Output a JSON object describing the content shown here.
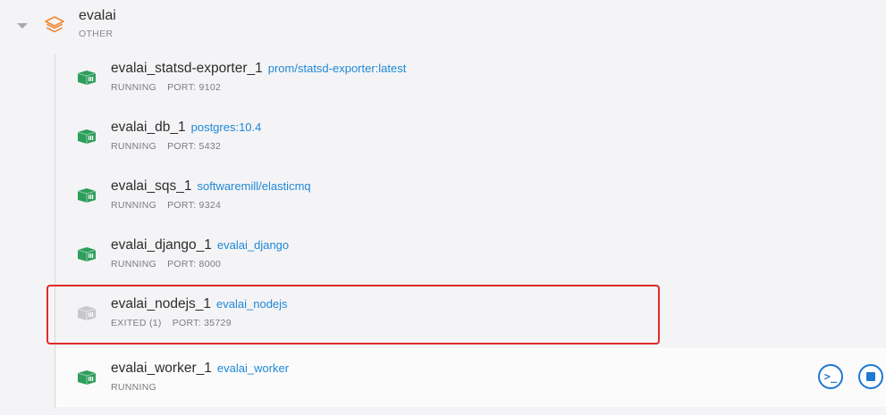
{
  "stack": {
    "name": "evalai",
    "type": "OTHER",
    "icon": "layers-icon",
    "icon_color": "#f08c3a"
  },
  "containers": [
    {
      "name": "evalai_statsd-exporter_1",
      "image": "prom/statsd-exporter:latest",
      "status": "RUNNING",
      "port": "PORT: 9102",
      "state_color": "#2e9e5b"
    },
    {
      "name": "evalai_db_1",
      "image": "postgres:10.4",
      "status": "RUNNING",
      "port": "PORT: 5432",
      "state_color": "#2e9e5b"
    },
    {
      "name": "evalai_sqs_1",
      "image": "softwaremill/elasticmq",
      "status": "RUNNING",
      "port": "PORT: 9324",
      "state_color": "#2e9e5b"
    },
    {
      "name": "evalai_django_1",
      "image": "evalai_django",
      "status": "RUNNING",
      "port": "PORT: 8000",
      "state_color": "#2e9e5b"
    },
    {
      "name": "evalai_nodejs_1",
      "image": "evalai_nodejs",
      "status": "EXITED (1)",
      "port": "PORT: 35729",
      "state_color": "#c8c8cc"
    },
    {
      "name": "evalai_worker_1",
      "image": "evalai_worker",
      "status": "RUNNING",
      "port": "",
      "state_color": "#2e9e5b"
    }
  ],
  "actions": {
    "terminal_icon": "terminal-icon",
    "terminal_glyph": ">_",
    "stop_icon": "stop-icon"
  },
  "colors": {
    "link": "#1e88d6",
    "accent": "#1f78d1",
    "highlight": "#e02a2a"
  }
}
